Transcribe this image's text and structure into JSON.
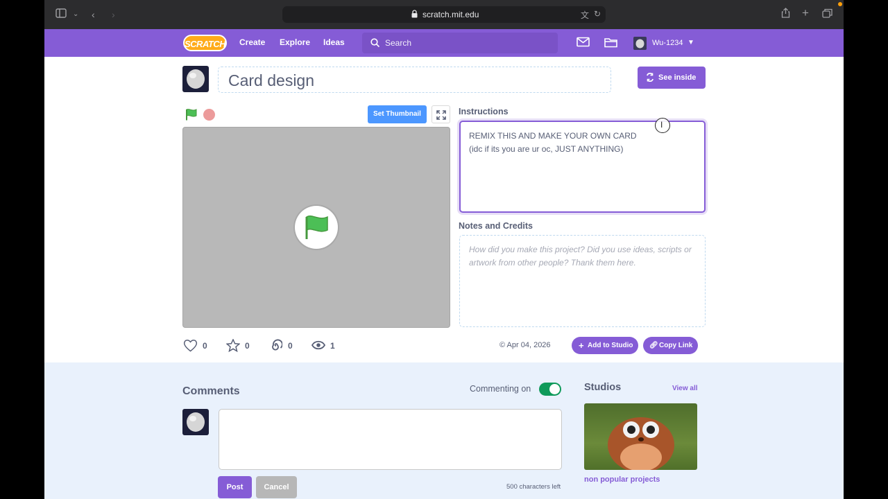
{
  "browser": {
    "url": "scratch.mit.edu"
  },
  "nav": {
    "logo": "SCRATCH",
    "links": [
      "Create",
      "Explore",
      "Ideas"
    ],
    "search_placeholder": "Search",
    "username": "Wu-1234"
  },
  "project": {
    "title": "Card design",
    "see_inside_label": "See inside",
    "set_thumbnail_label": "Set Thumbnail"
  },
  "instructions": {
    "heading": "Instructions",
    "lines": [
      "REMIX THIS AND MAKE YOUR OWN CARD",
      "(idc if its you are ur oc, JUST ANYTHING)"
    ]
  },
  "notes": {
    "heading": "Notes and Credits",
    "placeholder": "How did you make this project? Did you use ideas, scripts or artwork from other people? Thank them here."
  },
  "stats": {
    "loves": "0",
    "favorites": "0",
    "remixes": "0",
    "views": "1"
  },
  "meta": {
    "date": "© Apr 04, 2026",
    "add_to_studio_label": "Add to Studio",
    "copy_link_label": "Copy Link"
  },
  "comments": {
    "heading": "Comments",
    "commenting_label": "Commenting on",
    "post_label": "Post",
    "cancel_label": "Cancel",
    "chars_left": "500 characters left"
  },
  "studios": {
    "heading": "Studios",
    "view_all_label": "View all",
    "items": [
      {
        "name": "non popular projects"
      }
    ]
  },
  "colors": {
    "accent": "#855cd6",
    "blue": "#4c97ff"
  }
}
